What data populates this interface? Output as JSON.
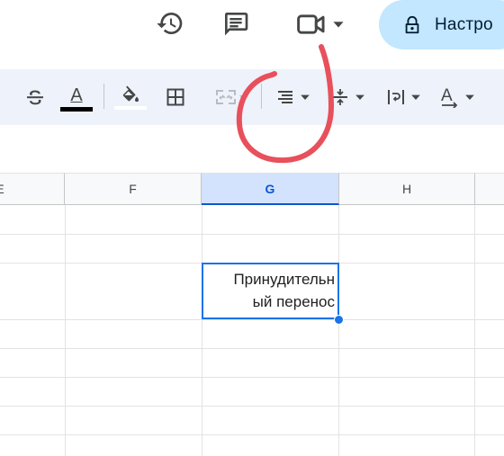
{
  "header": {
    "history_icon": "history-icon",
    "comments_icon": "comment-icon",
    "meet_icon": "video-camera-icon",
    "share_button_label": "Настро"
  },
  "toolbar": {
    "items": [
      {
        "name": "strikethrough",
        "icon": "strikethrough-icon"
      },
      {
        "name": "text-color",
        "icon": "text-color-icon",
        "label": "A",
        "color": "#000000"
      },
      {
        "name": "fill-color",
        "icon": "fill-color-icon",
        "color": "#ffffff"
      },
      {
        "name": "borders",
        "icon": "borders-icon"
      },
      {
        "name": "merge-cells",
        "icon": "merge-cells-icon"
      },
      {
        "name": "horizontal-align",
        "icon": "align-right-icon"
      },
      {
        "name": "vertical-align",
        "icon": "vertical-align-icon"
      },
      {
        "name": "text-wrapping",
        "icon": "text-wrap-icon"
      },
      {
        "name": "text-rotation",
        "icon": "text-rotation-icon",
        "label": "A"
      }
    ]
  },
  "grid": {
    "columns": [
      "E",
      "F",
      "G",
      "H"
    ],
    "selected_column": "G",
    "active_cell": {
      "column": "G",
      "lines": [
        "Принудительн",
        "ый перенос"
      ]
    }
  },
  "colors": {
    "accent": "#1a73e8",
    "share_bg": "#c2e7ff",
    "toolbar_bg": "#eef2fa",
    "annotation": "#e8505b"
  }
}
